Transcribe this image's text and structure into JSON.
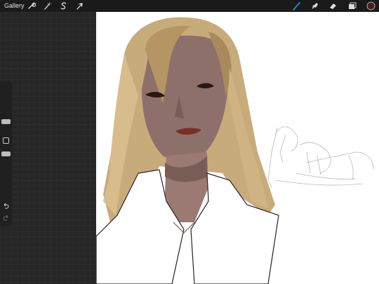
{
  "topbar": {
    "gallery_label": "Gallery",
    "actions_icon": "wrench-icon",
    "adjustments_icon": "magic-wand-icon",
    "selection_icon": "selection-s-icon",
    "transform_icon": "arrow-cursor-icon",
    "brush_icon": "brush-icon",
    "smudge_icon": "smudge-icon",
    "eraser_icon": "eraser-icon",
    "layers_icon": "layers-icon",
    "active_color": "#4a1a1a",
    "brush_active_color": "#2f7fe0"
  },
  "sidebar": {
    "brush_size_level": 0.15,
    "brush_opacity_level": 0.55,
    "undo_icon": "undo-icon",
    "redo_icon": "redo-icon"
  }
}
